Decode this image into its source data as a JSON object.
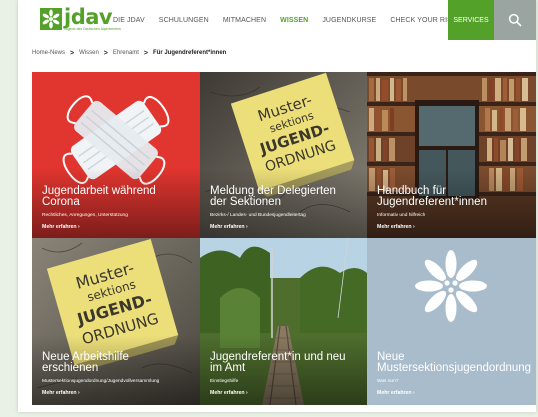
{
  "logo": {
    "text": "jdav",
    "subtitle": "Jugend des Deutschen Alpenvereins"
  },
  "nav": {
    "items": [
      {
        "label": "DIE JDAV"
      },
      {
        "label": "SCHULUNGEN"
      },
      {
        "label": "MITMACHEN"
      },
      {
        "label": "WISSEN",
        "active": true
      },
      {
        "label": "JUGENDKURSE"
      },
      {
        "label": "CHECK YOUR RISK"
      }
    ],
    "services_label": "SERVICES",
    "search_icon": "search-icon"
  },
  "breadcrumb": {
    "items": [
      "Home-News",
      "Wissen",
      "Ehrenamt",
      "Für Jugendreferent*innen"
    ],
    "separator": ">"
  },
  "cards": [
    {
      "title_lines": [
        "Jugendarbeit während",
        "Corona"
      ],
      "subtitle": "Rechtliches, Anregungen, Unterstützung",
      "link": "Mehr erfahren ›",
      "background": "#e1352f"
    },
    {
      "title_lines": [
        "Meldung der Delegierten",
        "der Sektionen"
      ],
      "subtitle": "Bezirks-/ Landes- und Bundesjugendleitertag",
      "link": "Mehr erfahren ›",
      "background": "#6a6250"
    },
    {
      "title_lines": [
        "Handbuch für",
        "Jugendreferent*innen"
      ],
      "subtitle": "Informativ und hilfreich",
      "link": "Mehr erfahren ›",
      "background": "#5a3a2a"
    },
    {
      "title_lines": [
        "Neue Arbeitshilfe",
        "erschienen"
      ],
      "subtitle": "Mustersektionsjugendordnung/Jugendvollversammlung",
      "link": "Mehr erfahren ›",
      "background": "#6a6250"
    },
    {
      "title_lines": [
        "Jugendreferent*in und neu",
        "im Amt"
      ],
      "subtitle": "Einstiegshilfe",
      "link": "Mehr erfahren ›",
      "background": "#5c7a3c"
    },
    {
      "title_lines": [
        "Neue",
        "Mustersektionsjugendordnung"
      ],
      "subtitle": "Was nun?",
      "link": "Mehr erfahren ›",
      "background": "#a9bccc"
    }
  ],
  "sticky_note": {
    "lines": [
      "Muster-",
      "sektions",
      "JUGEND-",
      "ORDNUNG"
    ]
  },
  "colors": {
    "brand_green": "#53a129",
    "search_gray": "#9aa4a0"
  }
}
